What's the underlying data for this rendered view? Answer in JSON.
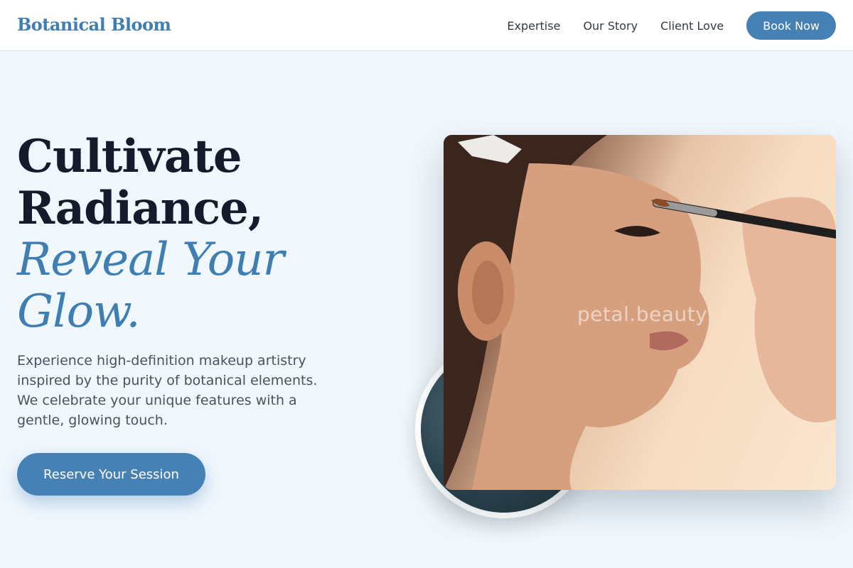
{
  "nav": {
    "logo": "Botanical Bloom",
    "links": [
      {
        "label": "Expertise"
      },
      {
        "label": "Our Story"
      },
      {
        "label": "Client Love"
      }
    ],
    "cta_label": "Book Now"
  },
  "hero": {
    "title_line1": "Cultivate",
    "title_line2": "Radiance,",
    "title_accent_line1": "Reveal Your",
    "title_accent_line2": "Glow.",
    "description": "Experience high-definition makeup artistry inspired by the purity of botanical elements. We celebrate your unique features with a gentle, glowing touch.",
    "cta_label": "Reserve Your Session"
  },
  "media": {
    "watermark": "petal.beauty"
  },
  "colors": {
    "accent": "#4681b6",
    "heading": "#141c2b",
    "background": "#f0f7fd"
  }
}
